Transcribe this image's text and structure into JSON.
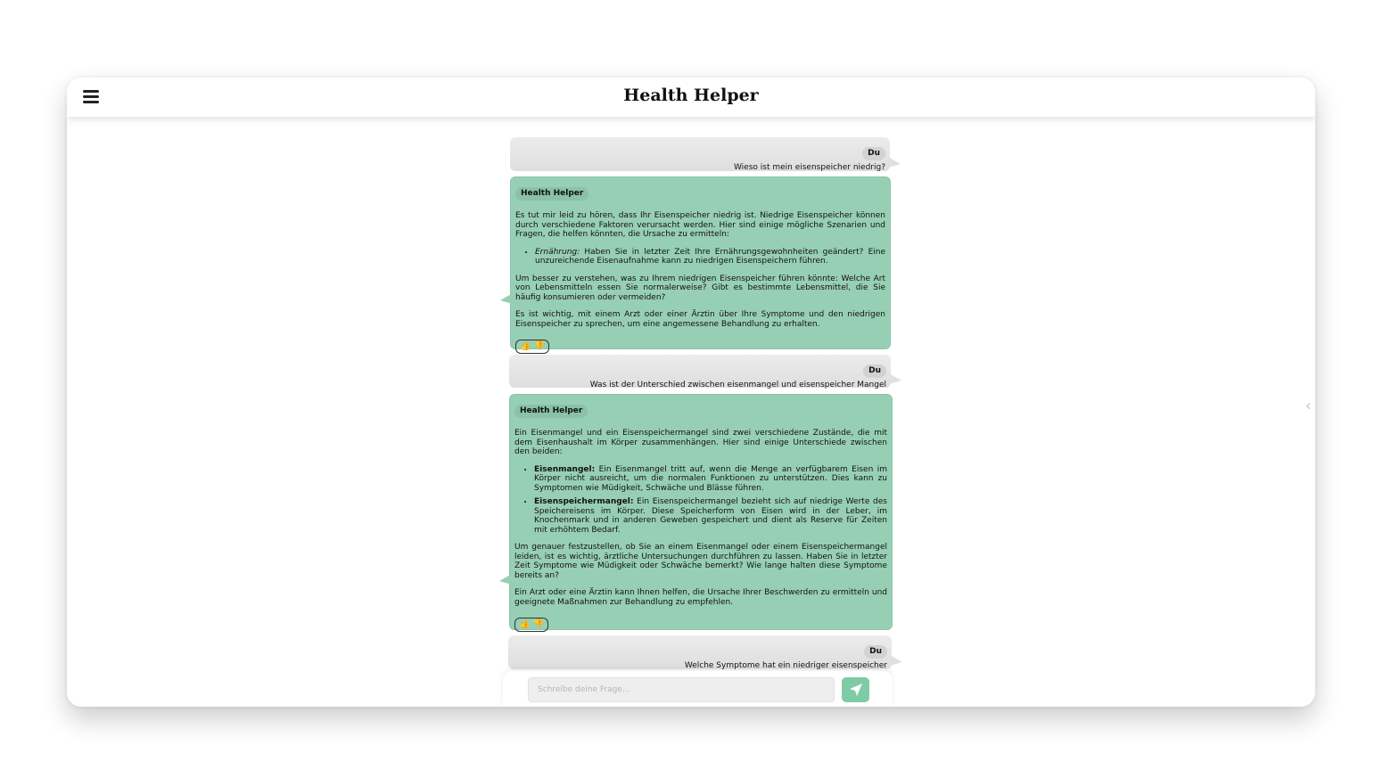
{
  "app": {
    "title": "Health Helper"
  },
  "messages": [
    {
      "role": "user",
      "sender": "Du",
      "text": "Wieso ist mein eisenspeicher niedrig?"
    },
    {
      "role": "bot",
      "sender": "Health Helper",
      "p1": "Es tut mir leid zu hören, dass Ihr Eisenspeicher niedrig ist. Niedrige Eisenspeicher können durch verschiedene Faktoren verursacht werden. Hier sind einige mögliche Szenarien und Fragen, die helfen könnten, die Ursache zu ermitteln:",
      "b1_label": "Ernährung:",
      "b1_text": " Haben Sie in letzter Zeit Ihre Ernährungsgewohnheiten geändert? Eine unzureichende Eisenaufnahme kann zu niedrigen Eisenspeichern führen.",
      "p2": "Um besser zu verstehen, was zu Ihrem niedrigen Eisenspeicher führen könnte: Welche Art von Lebensmitteln essen Sie normalerweise? Gibt es bestimmte Lebensmittel, die Sie häufig konsumieren oder vermeiden?",
      "p3": "Es ist wichtig, mit einem Arzt oder einer Ärztin über Ihre Symptome und den niedrigen Eisenspeicher zu sprechen, um eine angemessene Behandlung zu erhalten."
    },
    {
      "role": "user",
      "sender": "Du",
      "text": "Was ist der Unterschied zwischen eisenmangel und eisenspeicher Mangel"
    },
    {
      "role": "bot",
      "sender": "Health Helper",
      "p1": "Ein Eisenmangel und ein Eisenspeichermangel sind zwei verschiedene Zustände, die mit dem Eisenhaushalt im Körper zusammenhängen. Hier sind einige Unterschiede zwischen den beiden:",
      "b1_label": "Eisenmangel:",
      "b1_text": " Ein Eisenmangel tritt auf, wenn die Menge an verfügbarem Eisen im Körper nicht ausreicht, um die normalen Funktionen zu unterstützen. Dies kann zu Symptomen wie Müdigkeit, Schwäche und Blässe führen.",
      "b2_label": "Eisenspeichermangel:",
      "b2_text": " Ein Eisenspeichermangel bezieht sich auf niedrige Werte des Speichereisens im Körper. Diese Speicherform von Eisen wird in der Leber, im Knochenmark und in anderen Geweben gespeichert und dient als Reserve für Zeiten mit erhöhtem Bedarf.",
      "p2": "Um genauer festzustellen, ob Sie an einem Eisenmangel oder einem Eisenspeichermangel leiden, ist es wichtig, ärztliche Untersuchungen durchführen zu lassen. Haben Sie in letzter Zeit Symptome wie Müdigkeit oder Schwäche bemerkt? Wie lange halten diese Symptome bereits an?",
      "p3": "Ein Arzt oder eine Ärztin kann Ihnen helfen, die Ursache Ihrer Beschwerden zu ermitteln und geeignete Maßnahmen zur Behandlung zu empfehlen."
    },
    {
      "role": "user",
      "sender": "Du",
      "text": "Welche Symptome hat ein niedriger eisenspeicher"
    }
  ],
  "composer": {
    "placeholder": "Schreibe deine Frage..."
  },
  "icons": {
    "menu": "hamburger-icon",
    "send": "paper-plane-icon",
    "thumbs_up": "thumbs-up-icon",
    "thumbs_down": "thumbs-down-icon",
    "collapse": "chevron-left-icon"
  },
  "colors": {
    "bot_bubble": "#97cfb4",
    "user_bubble": "#e4e4e4",
    "send_button": "#7ecba6"
  }
}
